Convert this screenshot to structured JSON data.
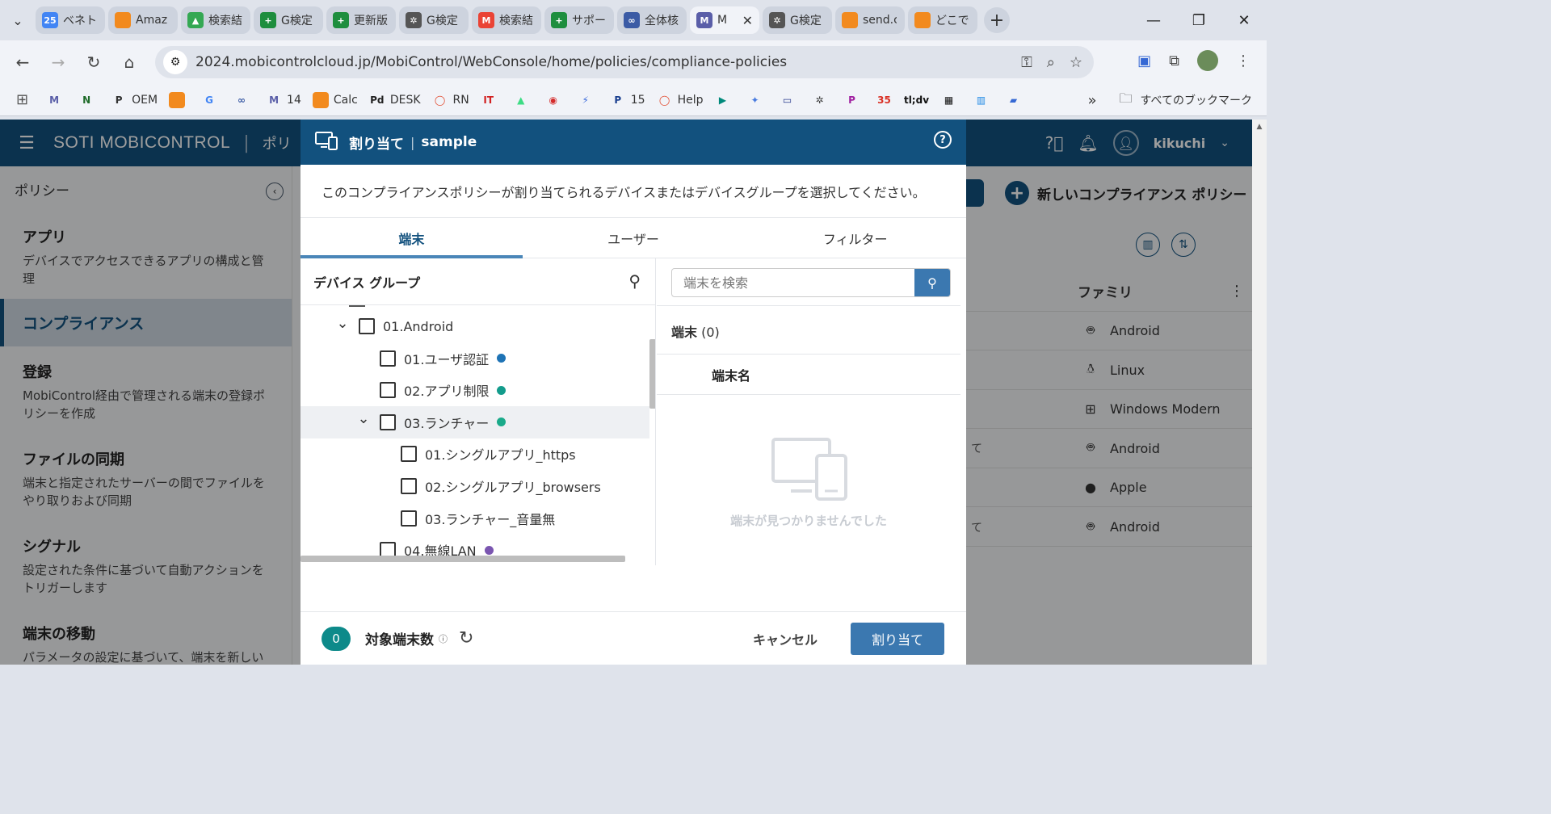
{
  "browser": {
    "tabs": [
      {
        "label": "ベネトI",
        "icon": "calendar-icon",
        "color": "#4285f4",
        "glyph": "25"
      },
      {
        "label": "Amaz",
        "icon": "box-icon",
        "color": "#f28a1e",
        "glyph": ""
      },
      {
        "label": "検索結",
        "icon": "drive-icon",
        "color": "#34a853",
        "glyph": "▲"
      },
      {
        "label": "G検定",
        "icon": "plus-icon",
        "color": "#1e8e3e",
        "glyph": "+"
      },
      {
        "label": "更新版",
        "icon": "plus-icon",
        "color": "#1e8e3e",
        "glyph": "+"
      },
      {
        "label": "G検定",
        "icon": "openai-icon",
        "color": "#555555",
        "glyph": "✲"
      },
      {
        "label": "検索結",
        "icon": "gmail-icon",
        "color": "#ea4335",
        "glyph": "M"
      },
      {
        "label": "サポー|",
        "icon": "plus-icon",
        "color": "#1e8e3e",
        "glyph": "+"
      },
      {
        "label": "全体核",
        "icon": "link-icon",
        "color": "#3b5ba5",
        "glyph": "∞"
      },
      {
        "label": "M",
        "icon": "mobicontrol-icon",
        "color": "#5a5ea8",
        "glyph": "M",
        "active": true
      },
      {
        "label": "G検定",
        "icon": "openai-icon",
        "color": "#555555",
        "glyph": "✲"
      },
      {
        "label": "send.c",
        "icon": "box-icon",
        "color": "#f28a1e",
        "glyph": ""
      },
      {
        "label": "どこでも",
        "icon": "box-icon",
        "color": "#f28a1e",
        "glyph": ""
      }
    ],
    "url": "2024.mobicontrolcloud.jp/MobiControl/WebConsole/home/policies/compliance-policies",
    "bookmarks": [
      {
        "label": "",
        "icon": "mobicontrol-icon",
        "color": "#5a5ea8",
        "glyph": "M"
      },
      {
        "label": "",
        "icon": "n-icon",
        "color": "#1f6b2a",
        "glyph": "N"
      },
      {
        "label": "OEM",
        "icon": "p-icon",
        "color": "#333333",
        "glyph": "P"
      },
      {
        "label": "",
        "icon": "box-icon",
        "color": "#f28a1e",
        "glyph": ""
      },
      {
        "label": "",
        "icon": "google-icon",
        "color": "#4285f4",
        "glyph": "G"
      },
      {
        "label": "",
        "icon": "link-icon",
        "color": "#3b5ba5",
        "glyph": "∞"
      },
      {
        "label": "14",
        "icon": "mobicontrol-icon",
        "color": "#5a5ea8",
        "glyph": "M"
      },
      {
        "label": "Calc",
        "icon": "box-icon",
        "color": "#f28a1e",
        "glyph": ""
      },
      {
        "label": "DESK",
        "icon": "pol-icon",
        "color": "#222222",
        "glyph": "Pd"
      },
      {
        "label": "RN",
        "icon": "ring-icon",
        "color": "#e24a2e",
        "glyph": "◯"
      },
      {
        "label": "",
        "icon": "it-icon",
        "color": "#d22222",
        "glyph": "IT"
      },
      {
        "label": "",
        "icon": "android-icon",
        "color": "#3ddc84",
        "glyph": "▲"
      },
      {
        "label": "",
        "icon": "eye-icon",
        "color": "#d42b2b",
        "glyph": "◉"
      },
      {
        "label": "",
        "icon": "bolt-icon",
        "color": "#3b6bdc",
        "glyph": "⚡"
      },
      {
        "label": "15",
        "icon": "p-icon",
        "color": "#1a3f8f",
        "glyph": "P"
      },
      {
        "label": "Help",
        "icon": "ring-icon",
        "color": "#e24a2e",
        "glyph": "◯"
      },
      {
        "label": "",
        "icon": "meet-icon",
        "color": "#00897b",
        "glyph": "▶"
      },
      {
        "label": "",
        "icon": "sparkle-icon",
        "color": "#4a7ce0",
        "glyph": "✦"
      },
      {
        "label": "",
        "icon": "window-icon",
        "color": "#2a3b8f",
        "glyph": "▭"
      },
      {
        "label": "",
        "icon": "openai-icon",
        "color": "#444444",
        "glyph": "✲"
      },
      {
        "label": "",
        "icon": "p-icon",
        "color": "#a020a0",
        "glyph": "P"
      },
      {
        "label": "",
        "icon": "calendar-icon",
        "color": "#d93025",
        "glyph": "35"
      },
      {
        "label": "",
        "icon": "tldv-icon",
        "color": "#111111",
        "glyph": "tl;dv"
      },
      {
        "label": "",
        "icon": "grid-logo-icon",
        "color": "#111111",
        "glyph": "▦"
      },
      {
        "label": "",
        "icon": "chart-icon",
        "color": "#1e88e5",
        "glyph": "▥"
      },
      {
        "label": "",
        "icon": "flag-icon",
        "color": "#3568d4",
        "glyph": "▰"
      }
    ],
    "all_bookmarks": "すべてのブックマーク"
  },
  "app": {
    "brand": "SOTI MOBICONTROL",
    "section": "ポリ",
    "username": "kikuchi",
    "sidebar_title": "ポリシー",
    "sidebar": [
      {
        "title": "アプリ",
        "desc": "デバイスでアクセスできるアプリの構成と管理"
      },
      {
        "title": "コンプライアンス",
        "desc": "",
        "active": true
      },
      {
        "title": "登録",
        "desc": "MobiControl経由で管理される端末の登録ポリシーを作成"
      },
      {
        "title": "ファイルの同期",
        "desc": "端末と指定されたサーバーの間でファイルをやり取りおよび同期"
      },
      {
        "title": "シグナル",
        "desc": "設定された条件に基づいて自動アクションをトリガーします"
      },
      {
        "title": "端末の移動",
        "desc": "パラメータの設定に基づいて、端末を新しいグループへ再配置"
      }
    ],
    "new_policy": "新しいコンプライアンス ポリシー",
    "column_family": "ファミリ",
    "families": [
      {
        "name": "Android",
        "icon": "android-icon",
        "frag": ""
      },
      {
        "name": "Linux",
        "icon": "linux-icon",
        "frag": ""
      },
      {
        "name": "Windows Modern",
        "icon": "windows-icon",
        "frag": ""
      },
      {
        "name": "Android",
        "icon": "android-icon",
        "frag": "て"
      },
      {
        "name": "Apple",
        "icon": "apple-icon",
        "frag": ""
      },
      {
        "name": "Android",
        "icon": "android-icon",
        "frag": "て"
      }
    ]
  },
  "modal": {
    "title": "割り当て",
    "subject": "sample",
    "description": "このコンプライアンスポリシーが割り当てられるデバイスまたはデバイスグループを選択してください。",
    "tabs": [
      "端末",
      "ユーザー",
      "フィルター"
    ],
    "active_tab": 0,
    "tree_header": "デバイス グループ",
    "tree": [
      {
        "label": "01.Android",
        "level": 0,
        "expanded": true,
        "dot": null
      },
      {
        "label": "01.ユーザ認証",
        "level": 1,
        "expanded": null,
        "dot": "#1e73b5"
      },
      {
        "label": "02.アプリ制限",
        "level": 1,
        "expanded": null,
        "dot": "#139c8c"
      },
      {
        "label": "03.ランチャー",
        "level": 1,
        "expanded": true,
        "dot": "#1aaa8a",
        "selected": true
      },
      {
        "label": "01.シングルアプリ_https",
        "level": 2,
        "expanded": null,
        "dot": null
      },
      {
        "label": "02.シングルアプリ_browsers",
        "level": 2,
        "expanded": null,
        "dot": null
      },
      {
        "label": "03.ランチャー_音量無",
        "level": 2,
        "expanded": null,
        "dot": null
      },
      {
        "label": "04.無線LAN",
        "level": 1,
        "expanded": null,
        "dot": "#7a55b0"
      }
    ],
    "search_placeholder": "端末を検索",
    "device_count_label": "端末",
    "device_count": "(0)",
    "device_column": "端末名",
    "empty_text": "端末が見つかりませんでした",
    "target_count": "0",
    "target_label": "対象端末数",
    "cancel": "キャンセル",
    "assign": "割り当て"
  }
}
